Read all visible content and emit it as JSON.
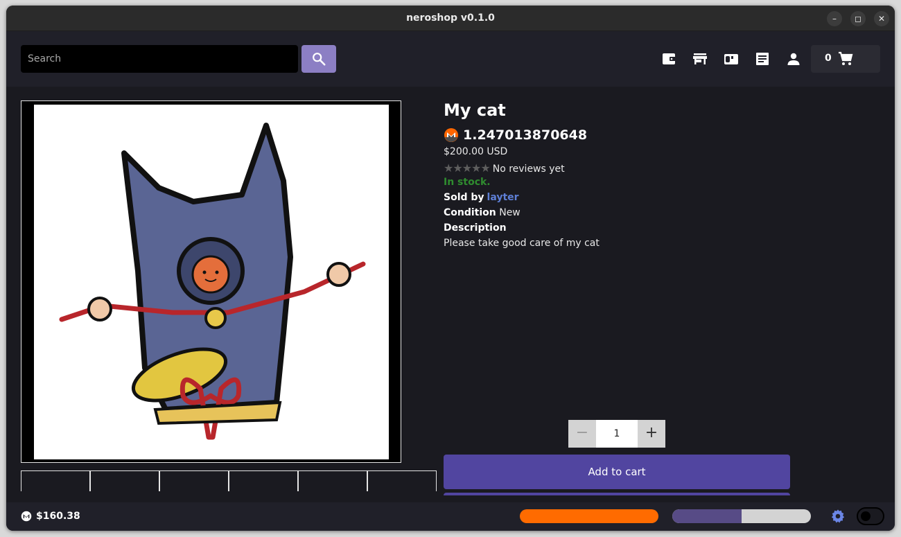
{
  "window": {
    "title": "neroshop v0.1.0"
  },
  "search": {
    "placeholder": "Search",
    "value": ""
  },
  "cart": {
    "count": "0"
  },
  "product": {
    "name": "My cat",
    "price_xmr": "1.247013870648",
    "price_usd": "$200.00 USD",
    "rating_stars": 0,
    "reviews_text": "No reviews yet",
    "stock_text": "In stock.",
    "sold_by_label": "Sold by",
    "seller": "layter",
    "condition_label": "Condition",
    "condition": "New",
    "description_label": "Description",
    "description": "Please take good care of my cat",
    "quantity": "1",
    "add_to_cart_label": "Add to cart"
  },
  "status": {
    "balance": "$160.38",
    "bar1_progress": 1.0,
    "bar2_progress": 0.5
  },
  "colors": {
    "accent": "#5145a0",
    "search_button": "#8c7fc4",
    "in_stock": "#2f8c2f",
    "seller_link": "#5e7fd6",
    "sync_bar": "#ff6b00",
    "monero": "#ff6600"
  },
  "icons": {
    "window_controls": [
      "minimize-icon",
      "maximize-icon",
      "close-icon"
    ],
    "nav": [
      "wallet-icon",
      "store-icon",
      "inbox-icon",
      "orders-icon",
      "account-icon",
      "cart-icon"
    ],
    "status": [
      "monero-icon",
      "gear-icon"
    ]
  }
}
